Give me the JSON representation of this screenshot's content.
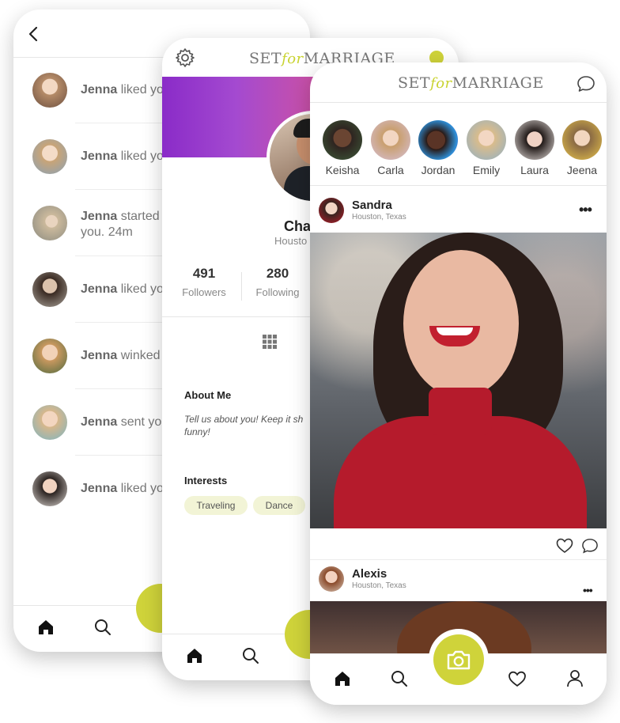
{
  "brand": {
    "left": "SET",
    "mid": "for",
    "right": "MARRIAGE"
  },
  "colors": {
    "accent": "#cfd33a",
    "brand_for": "#c9d330"
  },
  "notifications": [
    {
      "name": "Jenna",
      "action": "liked you"
    },
    {
      "name": "Jenna",
      "action": "liked you"
    },
    {
      "name": "Jenna",
      "action": "started f",
      "line2": "you.",
      "time": "24m"
    },
    {
      "name": "Jenna",
      "action": "liked you"
    },
    {
      "name": "Jenna",
      "action": "winked a"
    },
    {
      "name": "Jenna",
      "action": "sent you"
    },
    {
      "name": "Jenna",
      "action": "liked you"
    }
  ],
  "profile": {
    "name": "Chac",
    "location": "Housto",
    "followers_count": "491",
    "followers_label": "Followers",
    "following_count": "280",
    "following_label": "Following",
    "about_title": "About Me",
    "about_text_1": "Tell us about you! Keep it sh",
    "about_text_2": "funny!",
    "interests_title": "Interests",
    "interests": [
      "Traveling",
      "Dance"
    ]
  },
  "stories": [
    "Keisha",
    "Carla",
    "Jordan",
    "Emily",
    "Laura",
    "Jeena"
  ],
  "posts": [
    {
      "name": "Sandra",
      "location": "Houston, Texas"
    },
    {
      "name": "Alexis",
      "location": "Houston, Texas"
    }
  ],
  "icons": [
    "back-icon",
    "gear-icon",
    "chat-icon",
    "home-icon",
    "search-icon",
    "camera-icon",
    "heart-icon",
    "user-icon",
    "grid-icon",
    "more-icon"
  ]
}
